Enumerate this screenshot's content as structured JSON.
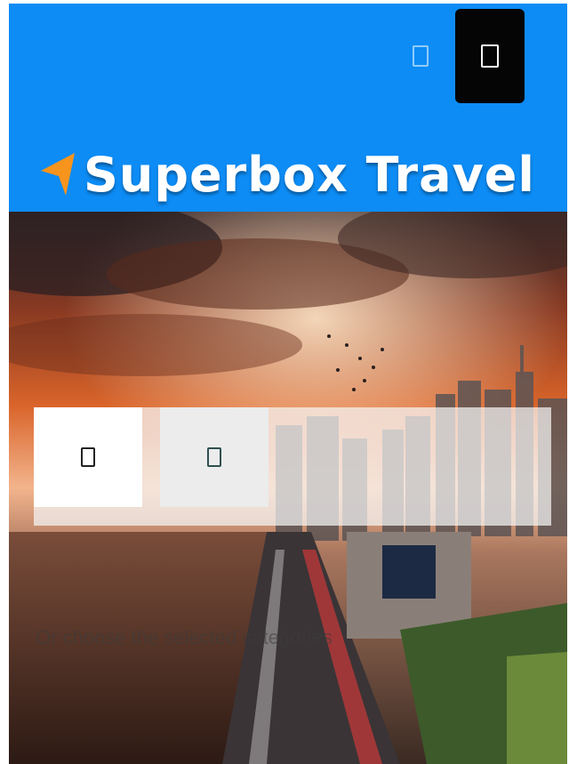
{
  "header": {
    "brand": "Superbox Travel",
    "bg_color": "#0d8cf5",
    "logo_accent_color": "#f7941d",
    "icons": {
      "left": "generic-icon",
      "menu": "menu-icon"
    }
  },
  "search_panel": {
    "tabs": [
      {
        "icon": "search-type-icon"
      },
      {
        "icon": "search-type-icon"
      }
    ]
  },
  "hint": {
    "text": "Or choose the selected categories"
  }
}
